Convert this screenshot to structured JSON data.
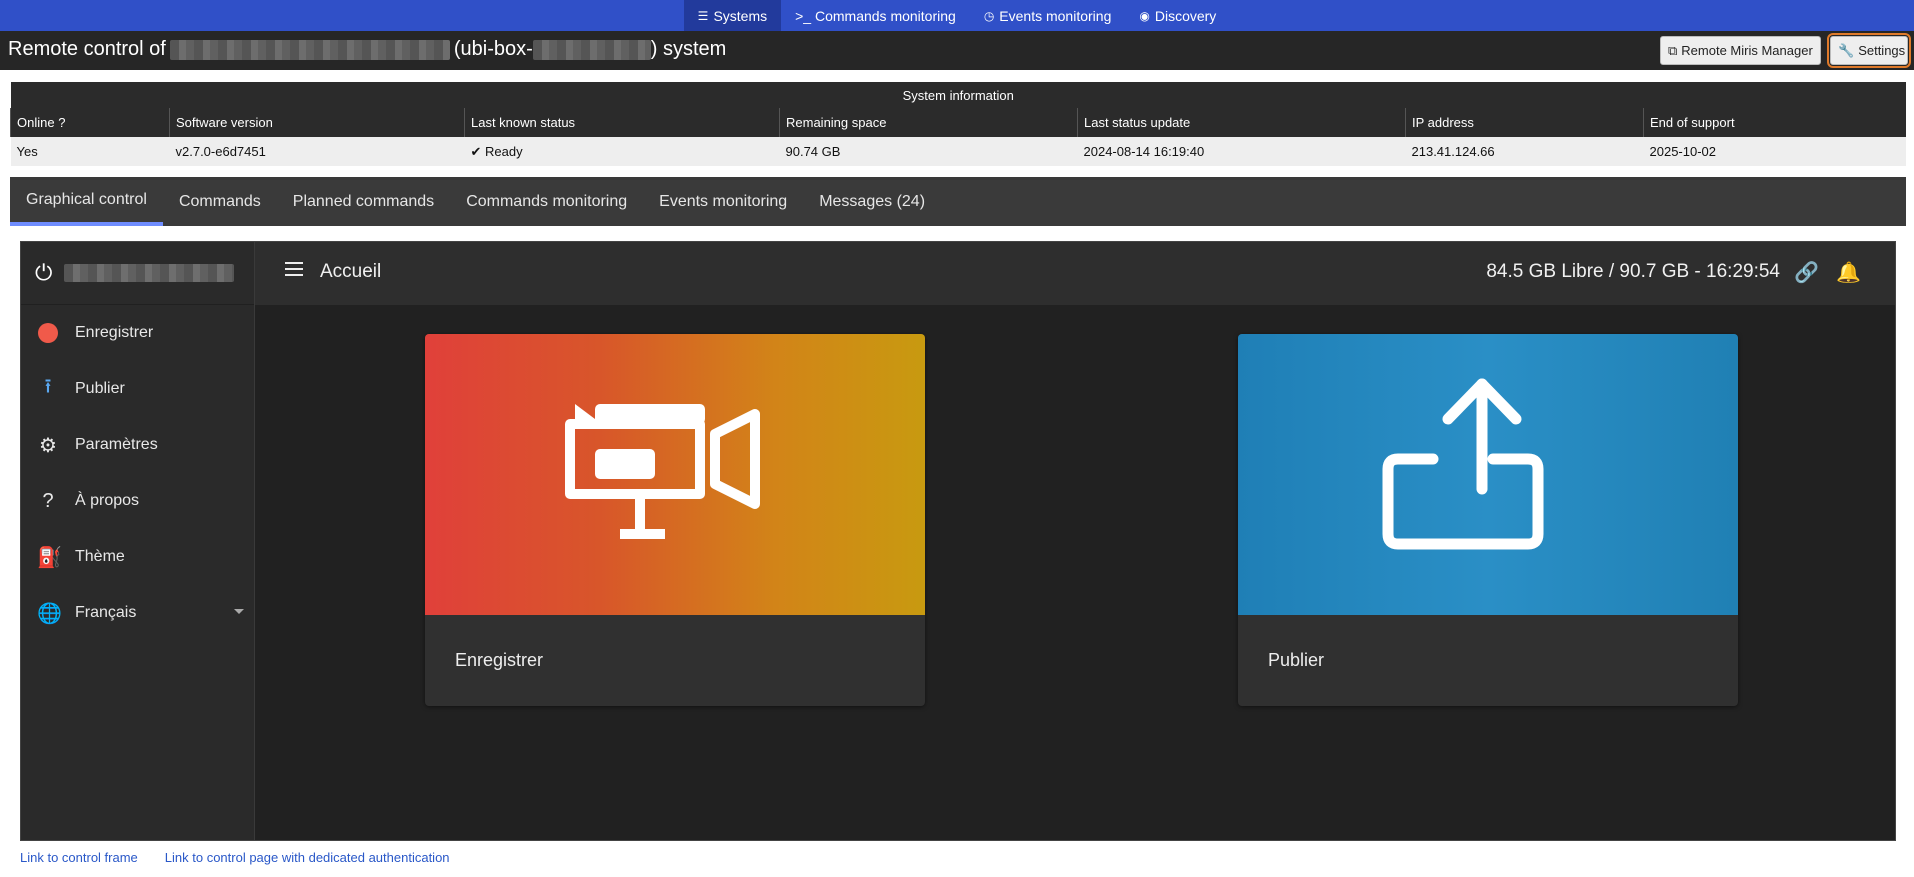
{
  "topnav": {
    "tabs": [
      {
        "label": "Systems",
        "icon": "server-icon"
      },
      {
        "label": ">_ Commands monitoring",
        "icon": "terminal-icon"
      },
      {
        "label": "Events monitoring",
        "icon": "clock-icon"
      },
      {
        "label": "Discovery",
        "icon": "radar-icon"
      }
    ]
  },
  "header": {
    "title_prefix": "Remote control of",
    "title_mid": "(ubi-box-",
    "title_suffix": ") system",
    "btn_miris": "Remote Miris Manager",
    "btn_settings": "Settings"
  },
  "sysinfo": {
    "caption": "System information",
    "headers": [
      "Online ?",
      "Software version",
      "Last known status",
      "Remaining space",
      "Last status update",
      "IP address",
      "End of support"
    ],
    "values": {
      "online": "Yes",
      "version": "v2.7.0-e6d7451",
      "status": "Ready",
      "space": "90.74 GB",
      "updated": "2024-08-14 16:19:40",
      "ip": "213.41.124.66",
      "eos": "2025-10-02"
    }
  },
  "tabs": [
    "Graphical control",
    "Commands",
    "Planned commands",
    "Commands monitoring",
    "Events monitoring",
    "Messages (24)"
  ],
  "app": {
    "appbar_title": "Accueil",
    "storage": "84.5 GB Libre / 90.7 GB - 16:29:54",
    "sidebar": [
      {
        "label": "Enregistrer",
        "icon": "record-dot-icon"
      },
      {
        "label": "Publier",
        "icon": "upload-icon"
      },
      {
        "label": "Paramètres",
        "icon": "gear-icon"
      },
      {
        "label": "À propos",
        "icon": "help-icon"
      },
      {
        "label": "Thème",
        "icon": "paint-bucket-icon"
      },
      {
        "label": "Français",
        "icon": "globe-icon"
      }
    ],
    "cards": [
      {
        "label": "Enregistrer"
      },
      {
        "label": "Publier"
      }
    ]
  },
  "footer_links": [
    "Link to control frame",
    "Link to control page with dedicated authentication"
  ],
  "colors": {
    "nav": "#3050c8",
    "accent_tab": "#6f8dff",
    "record": "#f05a4a",
    "settings_outline": "#e07a2a"
  }
}
